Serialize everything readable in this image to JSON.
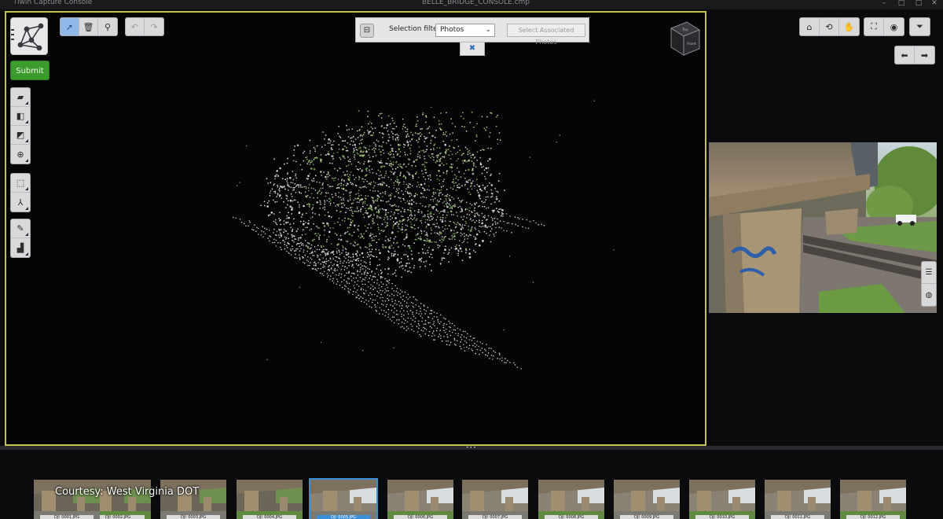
{
  "window": {
    "app_title": "iTwin Capture Console",
    "document_title": "BELLE_BRIDGE_CONSOLE.cmp",
    "controls": [
      "–",
      "□",
      "✕"
    ]
  },
  "left_panel": {
    "logo_icon": "network-graph-icon",
    "submit_label": "Submit",
    "tool_groups": [
      [
        "photos-icon",
        "photo-groups-icon",
        "control-points-icon",
        "tie-points-icon"
      ],
      [
        "bounding-box-icon",
        "axis-icon"
      ],
      [
        "measure-icon",
        "statistics-icon"
      ]
    ]
  },
  "top_toolbar": {
    "edit_tools": [
      "select-icon",
      "delete-icon",
      "search-icon"
    ],
    "history_tools": [
      "undo-icon",
      "redo-icon"
    ]
  },
  "selection_filter": {
    "label": "Selection filter:",
    "selected": "Photos",
    "associated_button": "Select Associated Photos"
  },
  "nav_cube": {
    "top_face": "Top",
    "front_face": "Front"
  },
  "right_toolbar": {
    "view_tools": [
      "home-icon",
      "orbit-icon",
      "pan-icon"
    ],
    "display_tools": [
      "fit-view-icon",
      "visibility-icon"
    ],
    "filter_tool": "filter-icon",
    "nav_tools": [
      "previous-arrow-icon",
      "next-arrow-icon"
    ]
  },
  "photo_preview": {
    "side_tools": [
      "layers-icon",
      "globe-icon"
    ]
  },
  "filmstrip": {
    "courtesy": "Courtesy: West Virginia DOT",
    "thumbnails": [
      {
        "caption": "DJI_0001.JPG",
        "selected": false
      },
      {
        "caption": "DJI_0002.JPG",
        "selected": false
      },
      {
        "caption": "DJI_0003.JPG",
        "selected": false
      },
      {
        "caption": "DJI_0004.JPG",
        "selected": false
      },
      {
        "caption": "DJI_0005.JPG",
        "selected": true
      },
      {
        "caption": "DJI_0006.JPG",
        "selected": false
      },
      {
        "caption": "DJI_0007.JPG",
        "selected": false
      },
      {
        "caption": "DJI_0008.JPG",
        "selected": false
      },
      {
        "caption": "DJI_0009.JPG",
        "selected": false
      },
      {
        "caption": "DJI_0010.JPG",
        "selected": false
      },
      {
        "caption": "DJI_0011.JPG",
        "selected": false
      },
      {
        "caption": "DJI_0012.JPG",
        "selected": false
      }
    ]
  },
  "colors": {
    "viewport_border": "#c5c24a",
    "submit_green": "#3d9b2e",
    "selection_blue": "#3a8fd9"
  }
}
